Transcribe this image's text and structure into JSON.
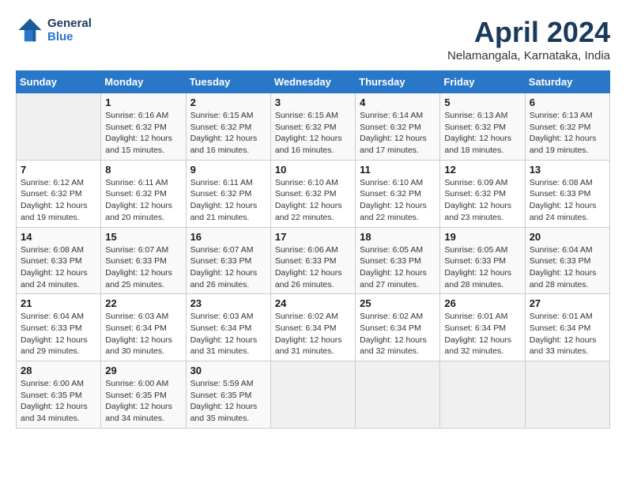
{
  "header": {
    "logo_line1": "General",
    "logo_line2": "Blue",
    "month": "April 2024",
    "location": "Nelamangala, Karnataka, India"
  },
  "weekdays": [
    "Sunday",
    "Monday",
    "Tuesday",
    "Wednesday",
    "Thursday",
    "Friday",
    "Saturday"
  ],
  "weeks": [
    [
      {
        "day": "",
        "info": ""
      },
      {
        "day": "1",
        "info": "Sunrise: 6:16 AM\nSunset: 6:32 PM\nDaylight: 12 hours\nand 15 minutes."
      },
      {
        "day": "2",
        "info": "Sunrise: 6:15 AM\nSunset: 6:32 PM\nDaylight: 12 hours\nand 16 minutes."
      },
      {
        "day": "3",
        "info": "Sunrise: 6:15 AM\nSunset: 6:32 PM\nDaylight: 12 hours\nand 16 minutes."
      },
      {
        "day": "4",
        "info": "Sunrise: 6:14 AM\nSunset: 6:32 PM\nDaylight: 12 hours\nand 17 minutes."
      },
      {
        "day": "5",
        "info": "Sunrise: 6:13 AM\nSunset: 6:32 PM\nDaylight: 12 hours\nand 18 minutes."
      },
      {
        "day": "6",
        "info": "Sunrise: 6:13 AM\nSunset: 6:32 PM\nDaylight: 12 hours\nand 19 minutes."
      }
    ],
    [
      {
        "day": "7",
        "info": "Sunrise: 6:12 AM\nSunset: 6:32 PM\nDaylight: 12 hours\nand 19 minutes."
      },
      {
        "day": "8",
        "info": "Sunrise: 6:11 AM\nSunset: 6:32 PM\nDaylight: 12 hours\nand 20 minutes."
      },
      {
        "day": "9",
        "info": "Sunrise: 6:11 AM\nSunset: 6:32 PM\nDaylight: 12 hours\nand 21 minutes."
      },
      {
        "day": "10",
        "info": "Sunrise: 6:10 AM\nSunset: 6:32 PM\nDaylight: 12 hours\nand 22 minutes."
      },
      {
        "day": "11",
        "info": "Sunrise: 6:10 AM\nSunset: 6:32 PM\nDaylight: 12 hours\nand 22 minutes."
      },
      {
        "day": "12",
        "info": "Sunrise: 6:09 AM\nSunset: 6:32 PM\nDaylight: 12 hours\nand 23 minutes."
      },
      {
        "day": "13",
        "info": "Sunrise: 6:08 AM\nSunset: 6:33 PM\nDaylight: 12 hours\nand 24 minutes."
      }
    ],
    [
      {
        "day": "14",
        "info": "Sunrise: 6:08 AM\nSunset: 6:33 PM\nDaylight: 12 hours\nand 24 minutes."
      },
      {
        "day": "15",
        "info": "Sunrise: 6:07 AM\nSunset: 6:33 PM\nDaylight: 12 hours\nand 25 minutes."
      },
      {
        "day": "16",
        "info": "Sunrise: 6:07 AM\nSunset: 6:33 PM\nDaylight: 12 hours\nand 26 minutes."
      },
      {
        "day": "17",
        "info": "Sunrise: 6:06 AM\nSunset: 6:33 PM\nDaylight: 12 hours\nand 26 minutes."
      },
      {
        "day": "18",
        "info": "Sunrise: 6:05 AM\nSunset: 6:33 PM\nDaylight: 12 hours\nand 27 minutes."
      },
      {
        "day": "19",
        "info": "Sunrise: 6:05 AM\nSunset: 6:33 PM\nDaylight: 12 hours\nand 28 minutes."
      },
      {
        "day": "20",
        "info": "Sunrise: 6:04 AM\nSunset: 6:33 PM\nDaylight: 12 hours\nand 28 minutes."
      }
    ],
    [
      {
        "day": "21",
        "info": "Sunrise: 6:04 AM\nSunset: 6:33 PM\nDaylight: 12 hours\nand 29 minutes."
      },
      {
        "day": "22",
        "info": "Sunrise: 6:03 AM\nSunset: 6:34 PM\nDaylight: 12 hours\nand 30 minutes."
      },
      {
        "day": "23",
        "info": "Sunrise: 6:03 AM\nSunset: 6:34 PM\nDaylight: 12 hours\nand 31 minutes."
      },
      {
        "day": "24",
        "info": "Sunrise: 6:02 AM\nSunset: 6:34 PM\nDaylight: 12 hours\nand 31 minutes."
      },
      {
        "day": "25",
        "info": "Sunrise: 6:02 AM\nSunset: 6:34 PM\nDaylight: 12 hours\nand 32 minutes."
      },
      {
        "day": "26",
        "info": "Sunrise: 6:01 AM\nSunset: 6:34 PM\nDaylight: 12 hours\nand 32 minutes."
      },
      {
        "day": "27",
        "info": "Sunrise: 6:01 AM\nSunset: 6:34 PM\nDaylight: 12 hours\nand 33 minutes."
      }
    ],
    [
      {
        "day": "28",
        "info": "Sunrise: 6:00 AM\nSunset: 6:35 PM\nDaylight: 12 hours\nand 34 minutes."
      },
      {
        "day": "29",
        "info": "Sunrise: 6:00 AM\nSunset: 6:35 PM\nDaylight: 12 hours\nand 34 minutes."
      },
      {
        "day": "30",
        "info": "Sunrise: 5:59 AM\nSunset: 6:35 PM\nDaylight: 12 hours\nand 35 minutes."
      },
      {
        "day": "",
        "info": ""
      },
      {
        "day": "",
        "info": ""
      },
      {
        "day": "",
        "info": ""
      },
      {
        "day": "",
        "info": ""
      }
    ]
  ]
}
